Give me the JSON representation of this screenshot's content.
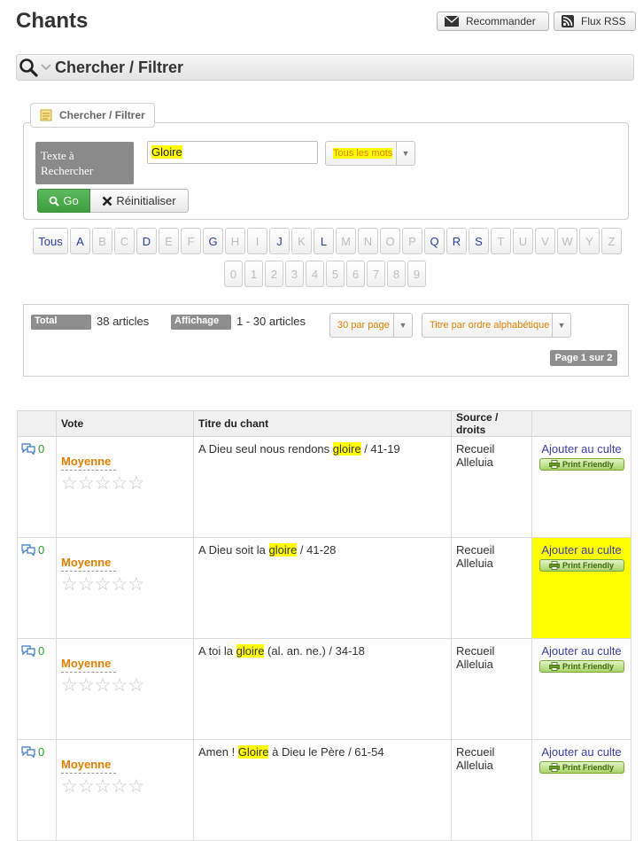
{
  "page_title": "Chants",
  "header_buttons": {
    "recommend": "Recommander",
    "rss": "Flux RSS"
  },
  "filter_bar_title": "Chercher / Filtrer",
  "filter_form": {
    "legend": "Chercher / Filtrer",
    "search_label": "Texte à Rechercher",
    "search_value": "Gloire",
    "mode_select": "Tous les mots",
    "go_label": "Go",
    "reset_label": "Réinitialiser"
  },
  "letters_row1": [
    {
      "label": "Tous",
      "on": true
    },
    {
      "label": "A",
      "on": true
    },
    {
      "label": "B",
      "on": false
    },
    {
      "label": "C",
      "on": false
    },
    {
      "label": "D",
      "on": true
    },
    {
      "label": "E",
      "on": false
    },
    {
      "label": "F",
      "on": false
    },
    {
      "label": "G",
      "on": true
    },
    {
      "label": "H",
      "on": false
    },
    {
      "label": "I",
      "on": false
    },
    {
      "label": "J",
      "on": true
    },
    {
      "label": "K",
      "on": false
    },
    {
      "label": "L",
      "on": true
    },
    {
      "label": "M",
      "on": false
    },
    {
      "label": "N",
      "on": false
    },
    {
      "label": "O",
      "on": false
    },
    {
      "label": "P",
      "on": false
    },
    {
      "label": "Q",
      "on": true
    },
    {
      "label": "R",
      "on": true
    },
    {
      "label": "S",
      "on": true
    },
    {
      "label": "T",
      "on": false
    },
    {
      "label": "U",
      "on": false
    },
    {
      "label": "V",
      "on": false
    },
    {
      "label": "W",
      "on": false
    },
    {
      "label": "Y",
      "on": false
    },
    {
      "label": "Z",
      "on": false
    }
  ],
  "letters_row2": [
    "0",
    "1",
    "2",
    "3",
    "4",
    "5",
    "6",
    "7",
    "8",
    "9"
  ],
  "stats": {
    "total_label": "Total",
    "total_value": "38 articles",
    "display_label": "Affichage",
    "display_value": "1 - 30 articles",
    "per_page": "30 par page",
    "sort": "Titre par ordre alphabétique",
    "page_info": "Page 1 sur 2"
  },
  "table": {
    "headers": [
      "",
      "Vote",
      "Titre du chant",
      "Source / droits",
      ""
    ],
    "rating_label": "Moyenne",
    "add_label": "Ajouter au culte",
    "print_label": "Print Friendly",
    "rows": [
      {
        "comments": "0",
        "title_before": "A Dieu seul nous rendons ",
        "title_hl": "gloire",
        "title_after": " / 41-19",
        "source1": "Recueil",
        "source2": "Alleluia",
        "highlight_action": false
      },
      {
        "comments": "0",
        "title_before": "A Dieu soit la ",
        "title_hl": "gloire",
        "title_after": " / 41-28",
        "source1": "Recueil",
        "source2": "Alleluia",
        "highlight_action": true
      },
      {
        "comments": "0",
        "title_before": "A toi la ",
        "title_hl": "gloire",
        "title_after": " (al. an. ne.) / 34-18",
        "source1": "Recueil",
        "source2": "Alleluia",
        "highlight_action": false
      },
      {
        "comments": "0",
        "title_before": "Amen ! ",
        "title_hl": "Gloire",
        "title_after": " à Dieu le Père / 61-54",
        "source1": "Recueil",
        "source2": "Alleluia",
        "highlight_action": false
      }
    ]
  }
}
